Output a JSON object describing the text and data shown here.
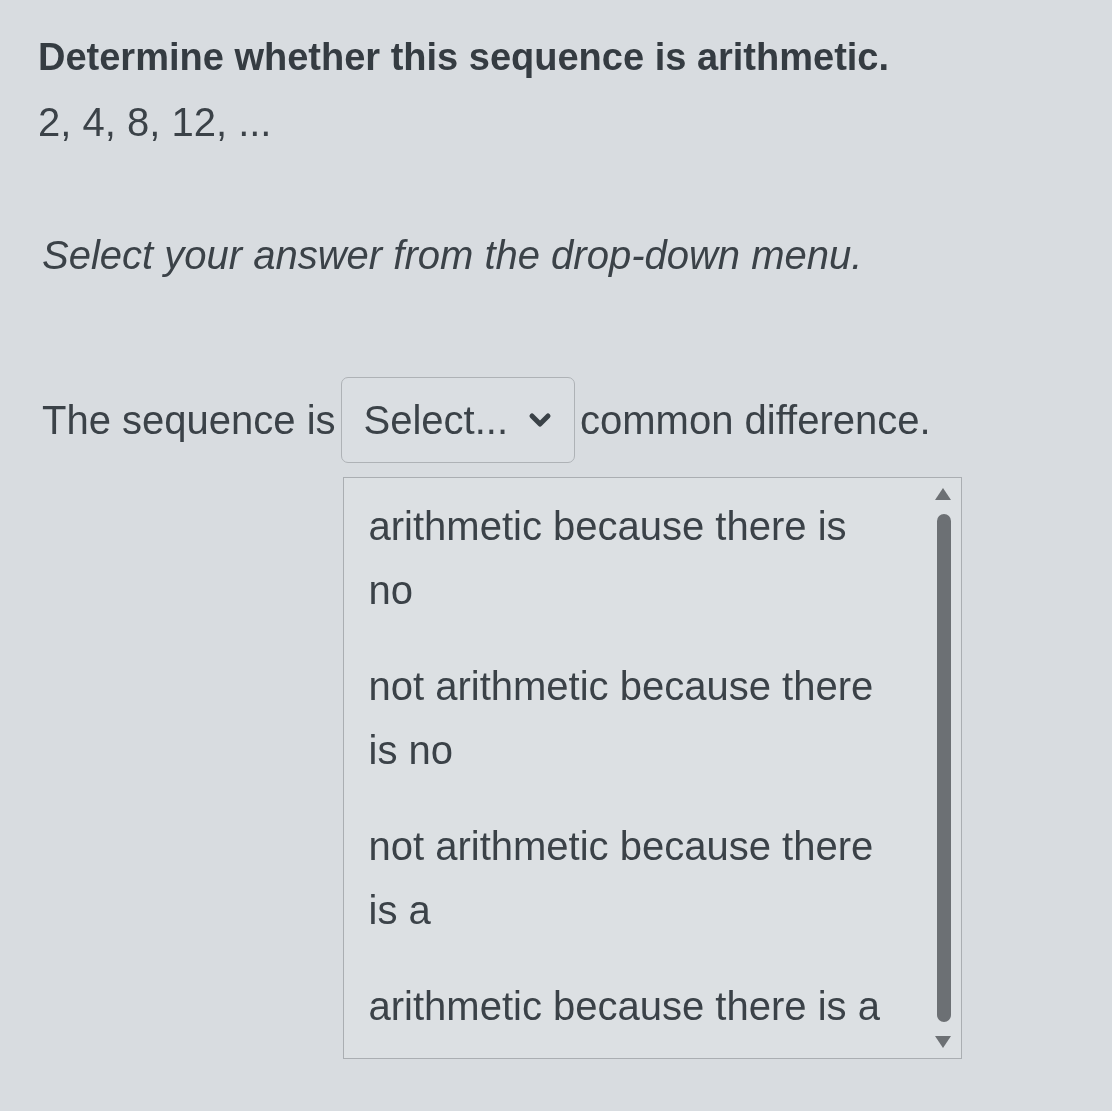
{
  "question": {
    "prompt": "Determine whether this sequence is arithmetic.",
    "sequence": "2, 4, 8, 12, ...",
    "instruction": "Select your answer from the drop-down menu."
  },
  "answer_sentence": {
    "before": "The sequence is",
    "select": {
      "placeholder": "Select...",
      "expanded": true,
      "options": [
        "arithmetic because there is no",
        "not arithmetic because there is no",
        "not arithmetic because there is a",
        "arithmetic because there is a"
      ]
    },
    "after": "common difference."
  }
}
